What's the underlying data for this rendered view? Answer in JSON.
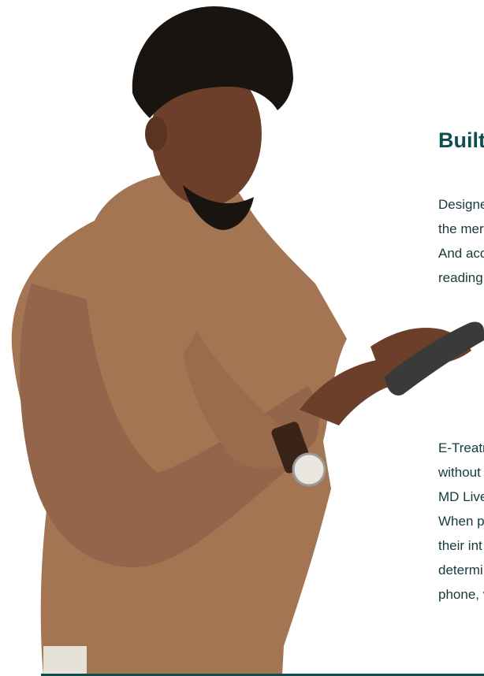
{
  "heading": "Built",
  "paragraphs": [
    [
      "Designe",
      "the mer",
      "And acc",
      "reading"
    ],
    [
      "E-Treatn",
      "without",
      "MD Live"
    ],
    [
      "When p",
      "their int",
      "determi",
      "phone, v"
    ]
  ],
  "colors": {
    "heading": "#0e4d50",
    "body_text": "#143a3c",
    "sweater": "#a47553",
    "skin": "#6b3f2a",
    "phone": "#3a3a3a"
  }
}
